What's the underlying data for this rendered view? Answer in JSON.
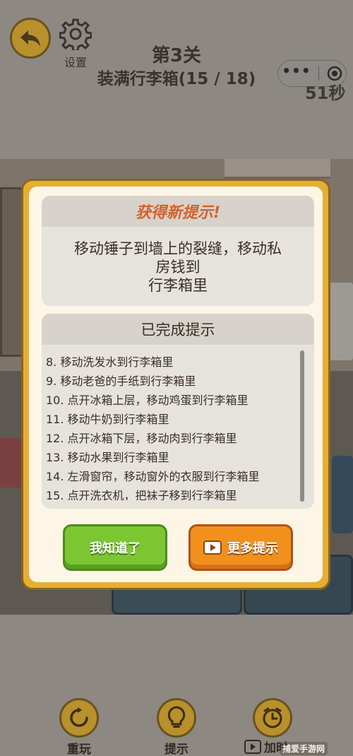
{
  "header": {
    "settings_label": "设置",
    "level_title": "第3关",
    "level_subtitle": "装满行李箱(15 / 18)",
    "capsule_more": "•••",
    "timer": "51秒"
  },
  "dialog": {
    "new_hint_title": "获得新提示!",
    "new_hint_lines": [
      "移动锤子到墙上的裂缝，移动私",
      "房钱到",
      "行李箱里"
    ],
    "done_hint_title": "已完成提示",
    "done_hints": [
      "8.  移动洗发水到行李箱里",
      "9.  移动老爸的手纸到行李箱里",
      "10. 点开冰箱上层，移动鸡蛋到行李箱里",
      "11. 移动牛奶到行李箱里",
      "12. 点开冰箱下层，移动肉到行李箱里",
      "13. 移动水果到行李箱里",
      "14. 左滑窗帘，移动窗外的衣服到行李箱里",
      "15. 点开洗衣机，把袜子移到行李箱里"
    ],
    "ok_label": "我知道了",
    "more_label": "更多提示"
  },
  "bottom": {
    "restart_label": "重玩",
    "hint_label": "提示",
    "add_time_label": "加时"
  },
  "watermark": "捕爱手游网",
  "colors": {
    "gold": "#b8902c",
    "dialog_border": "#e6ae35",
    "hint_title": "#d6612a",
    "ok_green": "#7cc632",
    "more_orange": "#f2901e"
  }
}
